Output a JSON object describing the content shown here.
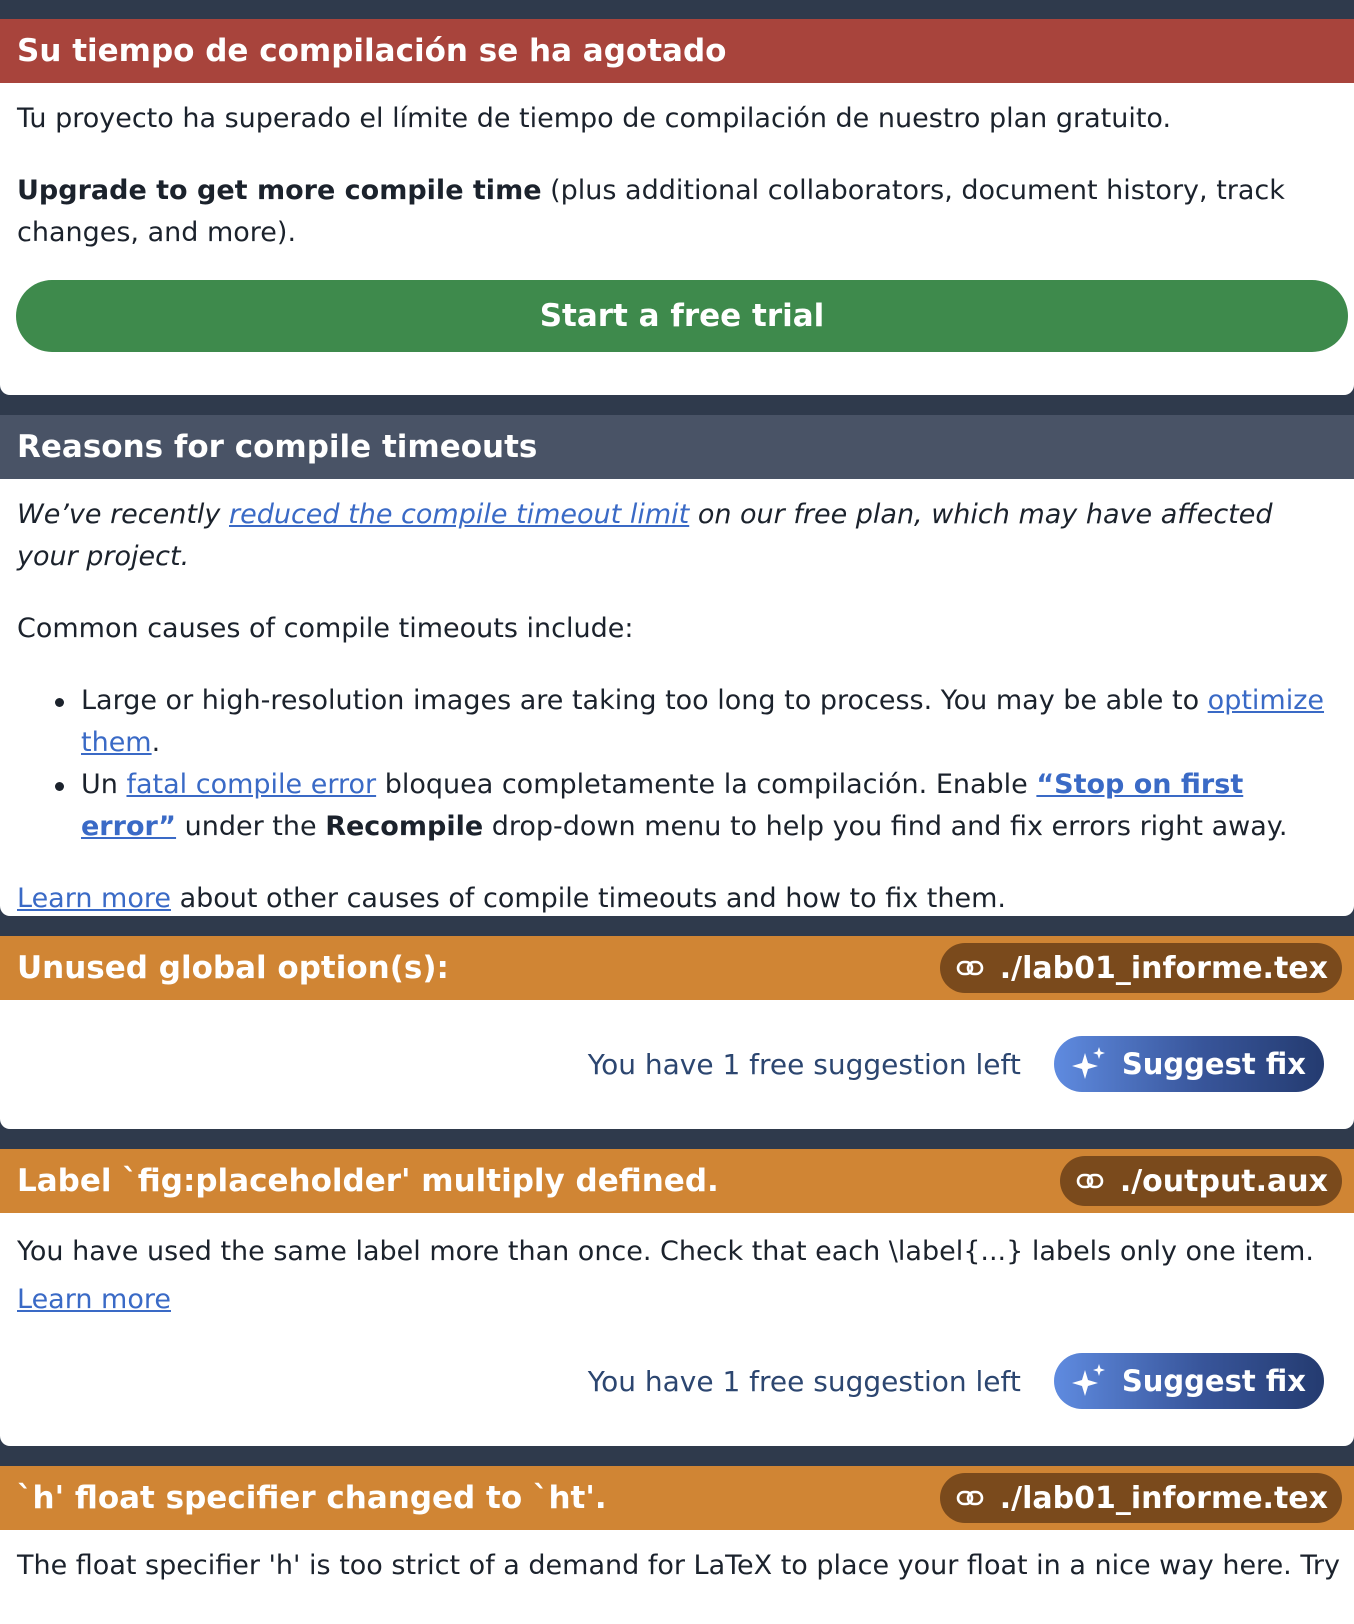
{
  "timeout_card": {
    "title": "Su tiempo de compilación se ha agotado",
    "message": "Tu proyecto ha superado el límite de tiempo de compilación de nuestro plan gratuito.",
    "upgrade_bold": "Upgrade to get more compile time",
    "upgrade_rest": " (plus additional collaborators, document history, track changes, and more).",
    "trial_button": "Start a free trial"
  },
  "reasons_card": {
    "title": "Reasons for compile timeouts",
    "intro_pre": "We’ve recently ",
    "intro_link": "reduced the compile timeout limit",
    "intro_post": " on our free plan, which may have affected your project.",
    "common_causes": "Common causes of compile timeouts include:",
    "cause1_pre": "Large or high-resolution images are taking too long to process. You may be able to ",
    "cause1_link": "optimize them",
    "cause1_post": ".",
    "cause2_pre": "Un ",
    "cause2_link": "fatal compile error",
    "cause2_mid": " bloquea completamente la compilación. Enable ",
    "cause2_link2": "“Stop on first error”",
    "cause2_mid2": " under the ",
    "cause2_bold": "Recompile",
    "cause2_post": " drop-down menu to help you find and fix errors right away.",
    "learn_more_link": "Learn more",
    "learn_more_rest": " about other causes of compile timeouts and how to fix them."
  },
  "warnings": [
    {
      "title": "Unused global option(s):",
      "file": "./lab01_informe.tex",
      "suggestion_note": "You have 1 free suggestion left",
      "suggest_button": "Suggest fix"
    },
    {
      "title": "Label `fig:placeholder' multiply defined.",
      "file": "./output.aux",
      "description": "You have used the same label more than once. Check that each \\label{...} labels only one item.",
      "learn_more": "Learn more",
      "suggestion_note": "You have 1 free suggestion left",
      "suggest_button": "Suggest fix"
    },
    {
      "title": "`h' float specifier changed to `ht'.",
      "file": "./lab01_informe.tex",
      "description": "The float specifier 'h' is too strict of a demand for LaTeX to place your float in a nice way here. Try"
    }
  ],
  "icons": {
    "file_link": "link-icon",
    "suggest": "sparkle-icon"
  },
  "colors": {
    "error_header": "#a8443c",
    "info_header": "#495366",
    "warning_header": "#d08534",
    "trial_button": "#3e8a4c",
    "link": "#3a6ac6"
  }
}
